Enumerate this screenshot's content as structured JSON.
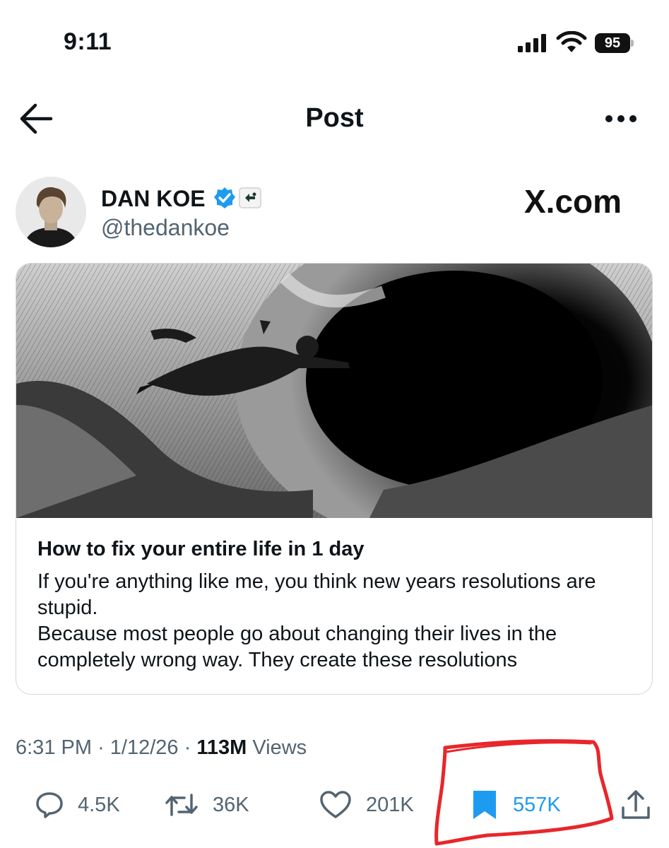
{
  "status_bar": {
    "time": "9:11",
    "battery": "95"
  },
  "header": {
    "title": "Post"
  },
  "author": {
    "name": "DAN KOE",
    "handle": "@thedankoe"
  },
  "brand": "X.com",
  "card": {
    "title": "How to fix your entire life in 1 day",
    "description": "If you're anything like me, you think new years resolutions are stupid.\nBecause most people go about changing their lives in the completely wrong way. They create these resolutions"
  },
  "meta": {
    "time": "6:31 PM",
    "date": "1/12/26",
    "views_count": "113M",
    "views_label": "Views"
  },
  "actions": {
    "replies": "4.5K",
    "reposts": "36K",
    "likes": "201K",
    "bookmarks": "557K"
  },
  "colors": {
    "accent": "#1d9bf0",
    "annotation": "#e8262a",
    "muted": "#536471"
  }
}
